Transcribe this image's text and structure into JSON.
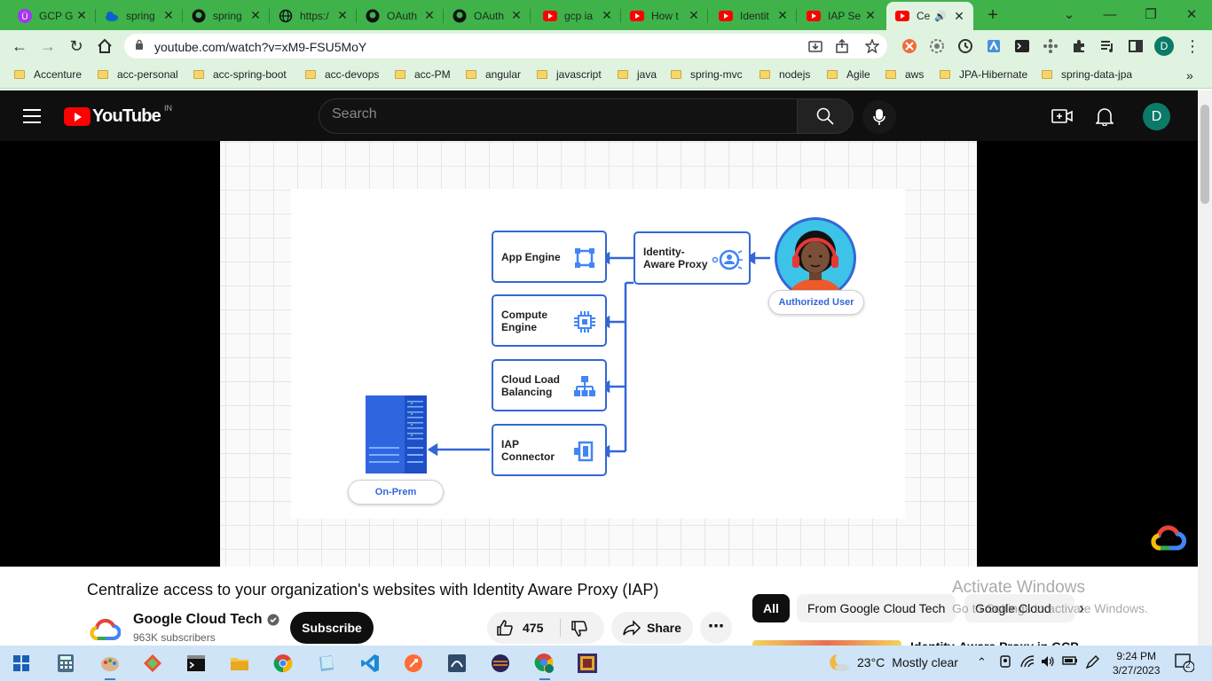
{
  "browser": {
    "tabs": [
      {
        "title": "GCP G",
        "favicon": "udemy-icon",
        "color": "#a435f0"
      },
      {
        "title": "spring",
        "favicon": "onedrive-cloud-icon",
        "color": "#0a64c8"
      },
      {
        "title": "spring",
        "favicon": "github-icon",
        "color": "#111111"
      },
      {
        "title": "https:/",
        "favicon": "globe-icon",
        "color": "#111111"
      },
      {
        "title": "OAuth",
        "favicon": "github-icon",
        "color": "#111111"
      },
      {
        "title": "OAuth",
        "favicon": "github-icon",
        "color": "#111111"
      },
      {
        "title": "gcp ia",
        "favicon": "youtube-icon",
        "color": "#ff0000"
      },
      {
        "title": "How t",
        "favicon": "youtube-icon",
        "color": "#ff0000"
      },
      {
        "title": "Identit",
        "favicon": "youtube-icon",
        "color": "#ff0000"
      },
      {
        "title": "IAP Se",
        "favicon": "youtube-icon",
        "color": "#ff0000"
      },
      {
        "title": "Ce",
        "favicon": "youtube-icon",
        "color": "#ff0000",
        "active": true
      }
    ],
    "new_tab_label": "+",
    "url": "youtube.com/watch?v=xM9-FSU5MoY",
    "bookmarks": [
      "Accenture",
      "acc-personal",
      "acc-spring-boot",
      "acc-devops",
      "acc-PM",
      "angular",
      "javascript",
      "java",
      "spring-mvc",
      "nodejs",
      "Agile",
      "aws",
      "JPA-Hibernate",
      "spring-data-jpa"
    ],
    "profile_initial": "D",
    "overflow_label": "»"
  },
  "youtube": {
    "logo_text": "YouTube",
    "region": "IN",
    "search_placeholder": "Search",
    "avatar_initial": "D"
  },
  "diagram": {
    "nodes": {
      "app_engine": "App Engine",
      "compute_engine_1": "Compute",
      "compute_engine_2": "Engine",
      "cloud_lb_1": "Cloud Load",
      "cloud_lb_2": "Balancing",
      "iap_connector_1": "IAP",
      "iap_connector_2": "Connector",
      "iap_1": "Identity-",
      "iap_2": "Aware Proxy"
    },
    "authorized_user": "Authorized User",
    "on_prem": "On-Prem",
    "accent_color": "#3367d6"
  },
  "video": {
    "title": "Centralize access to your organization's websites with Identity Aware Proxy (IAP)",
    "channel": "Google Cloud Tech",
    "subscribers": "963K subscribers",
    "subscribe_label": "Subscribe",
    "likes": "475",
    "share_label": "Share",
    "more_label": "⋯"
  },
  "sidebar": {
    "chips": [
      "All",
      "From Google Cloud Tech",
      "Google Cloud"
    ],
    "next_label": "›",
    "rec_title": "Identity-Aware Proxy in GCP"
  },
  "watermark": {
    "line1": "Activate Windows",
    "line2": "Go to Settings to activate Windows."
  },
  "taskbar": {
    "temperature": "23°C",
    "weather": "Mostly clear",
    "time": "9:24 PM",
    "date": "3/27/2023",
    "notifications": "2"
  }
}
